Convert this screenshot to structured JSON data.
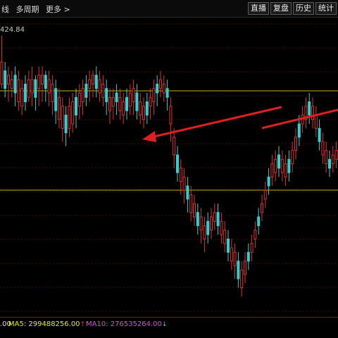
{
  "toolbar": {
    "left_items": [
      "线",
      "多周期",
      "更多 >"
    ],
    "right_buttons": [
      "直播",
      "复盘",
      "历史",
      "统计"
    ]
  },
  "price_label": "424.84",
  "ma_bar": {
    "ma0_value": ".00",
    "ma5_label": "MA5: 299488256.00",
    "ma10_label": "MA10: 276535264.00",
    "ma5_arrow": "↑",
    "ma10_arrow": "↓"
  },
  "annotations": {
    "horizontal_lines_color": "#c8b000",
    "arrows_color": "#e02020"
  },
  "chart_data": {
    "type": "candlestick",
    "colors": {
      "up": "#e03030",
      "down": "#30d0d0"
    },
    "candles": [
      [
        440,
        445,
        470,
        500
      ],
      [
        430,
        440,
        460,
        470
      ],
      [
        425,
        445,
        455,
        465
      ],
      [
        430,
        440,
        450,
        460
      ],
      [
        420,
        435,
        455,
        465
      ],
      [
        415,
        425,
        450,
        460
      ],
      [
        410,
        420,
        440,
        450
      ],
      [
        415,
        425,
        445,
        455
      ],
      [
        425,
        430,
        450,
        460
      ],
      [
        420,
        435,
        450,
        465
      ],
      [
        415,
        430,
        450,
        455
      ],
      [
        420,
        440,
        455,
        465
      ],
      [
        425,
        445,
        455,
        465
      ],
      [
        425,
        440,
        455,
        460
      ],
      [
        420,
        435,
        450,
        460
      ],
      [
        410,
        425,
        445,
        455
      ],
      [
        400,
        415,
        440,
        450
      ],
      [
        395,
        405,
        430,
        440
      ],
      [
        380,
        395,
        420,
        430
      ],
      [
        375,
        390,
        410,
        420
      ],
      [
        385,
        395,
        420,
        430
      ],
      [
        390,
        400,
        425,
        435
      ],
      [
        395,
        410,
        430,
        440
      ],
      [
        405,
        420,
        435,
        445
      ],
      [
        410,
        425,
        440,
        450
      ],
      [
        420,
        430,
        445,
        455
      ],
      [
        425,
        440,
        450,
        460
      ],
      [
        430,
        445,
        455,
        460
      ],
      [
        430,
        440,
        455,
        465
      ],
      [
        425,
        435,
        450,
        460
      ],
      [
        420,
        430,
        445,
        455
      ],
      [
        410,
        425,
        440,
        450
      ],
      [
        400,
        415,
        430,
        440
      ],
      [
        405,
        420,
        430,
        440
      ],
      [
        410,
        425,
        435,
        445
      ],
      [
        405,
        415,
        430,
        440
      ],
      [
        400,
        410,
        425,
        435
      ],
      [
        405,
        415,
        430,
        440
      ],
      [
        410,
        420,
        435,
        445
      ],
      [
        410,
        425,
        440,
        450
      ],
      [
        405,
        415,
        435,
        445
      ],
      [
        400,
        410,
        425,
        435
      ],
      [
        395,
        405,
        420,
        430
      ],
      [
        400,
        410,
        425,
        435
      ],
      [
        405,
        420,
        430,
        440
      ],
      [
        410,
        425,
        440,
        450
      ],
      [
        420,
        435,
        445,
        455
      ],
      [
        430,
        440,
        450,
        460
      ],
      [
        425,
        435,
        445,
        455
      ],
      [
        415,
        430,
        440,
        450
      ],
      [
        380,
        400,
        420,
        430
      ],
      [
        350,
        365,
        385,
        395
      ],
      [
        335,
        345,
        365,
        375
      ],
      [
        320,
        335,
        350,
        360
      ],
      [
        310,
        325,
        340,
        350
      ],
      [
        300,
        315,
        330,
        340
      ],
      [
        290,
        300,
        320,
        330
      ],
      [
        285,
        295,
        310,
        320
      ],
      [
        275,
        285,
        300,
        310
      ],
      [
        265,
        280,
        295,
        305
      ],
      [
        255,
        270,
        285,
        295
      ],
      [
        265,
        275,
        290,
        300
      ],
      [
        270,
        280,
        295,
        305
      ],
      [
        280,
        290,
        300,
        310
      ],
      [
        275,
        285,
        300,
        310
      ],
      [
        265,
        275,
        290,
        300
      ],
      [
        255,
        265,
        280,
        290
      ],
      [
        245,
        255,
        270,
        280
      ],
      [
        235,
        245,
        260,
        270
      ],
      [
        225,
        240,
        255,
        265
      ],
      [
        215,
        225,
        245,
        255
      ],
      [
        205,
        215,
        235,
        245
      ],
      [
        220,
        230,
        245,
        255
      ],
      [
        235,
        245,
        255,
        265
      ],
      [
        245,
        255,
        265,
        275
      ],
      [
        260,
        270,
        280,
        290
      ],
      [
        275,
        285,
        295,
        305
      ],
      [
        290,
        300,
        310,
        320
      ],
      [
        305,
        315,
        325,
        335
      ],
      [
        320,
        330,
        340,
        350
      ],
      [
        330,
        340,
        355,
        365
      ],
      [
        335,
        345,
        360,
        370
      ],
      [
        340,
        350,
        365,
        375
      ],
      [
        335,
        345,
        360,
        370
      ],
      [
        330,
        340,
        355,
        365
      ],
      [
        335,
        345,
        360,
        370
      ],
      [
        345,
        355,
        370,
        380
      ],
      [
        360,
        370,
        385,
        395
      ],
      [
        375,
        385,
        400,
        410
      ],
      [
        390,
        400,
        410,
        420
      ],
      [
        395,
        405,
        420,
        430
      ],
      [
        400,
        410,
        425,
        435
      ],
      [
        395,
        405,
        420,
        430
      ],
      [
        385,
        395,
        410,
        420
      ],
      [
        370,
        380,
        395,
        405
      ],
      [
        355,
        365,
        380,
        390
      ],
      [
        345,
        355,
        370,
        380
      ],
      [
        340,
        350,
        360,
        370
      ],
      [
        345,
        355,
        365,
        375
      ],
      [
        350,
        360,
        370,
        380
      ]
    ]
  }
}
